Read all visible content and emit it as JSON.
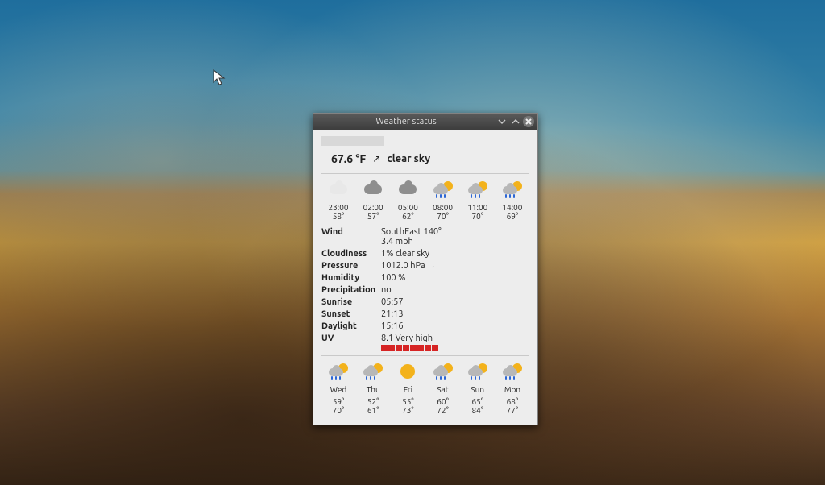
{
  "window": {
    "title": "Weather status"
  },
  "current": {
    "temp": "67.6 °F",
    "trend_arrow": "↗",
    "desc": "clear sky"
  },
  "hourly": [
    {
      "icon": "cloud-white",
      "time": "23:00",
      "temp": "58°"
    },
    {
      "icon": "cloud-dark",
      "time": "02:00",
      "temp": "57°"
    },
    {
      "icon": "cloud-dark",
      "time": "05:00",
      "temp": "62°"
    },
    {
      "icon": "rain-sun",
      "time": "08:00",
      "temp": "70°"
    },
    {
      "icon": "rain-sun",
      "time": "11:00",
      "temp": "70°"
    },
    {
      "icon": "rain-sun",
      "time": "14:00",
      "temp": "69°"
    }
  ],
  "details": {
    "wind_label": "Wind",
    "wind_value": "SouthEast 140°\n3.4 mph",
    "cloudiness_label": "Cloudiness",
    "cloudiness_value": "1% clear sky",
    "pressure_label": "Pressure",
    "pressure_value": "1012.0 hPa →",
    "humidity_label": "Humidity",
    "humidity_value": "100 %",
    "precip_label": "Precipitation",
    "precip_value": "no",
    "sunrise_label": "Sunrise",
    "sunrise_value": "05:57",
    "sunset_label": "Sunset",
    "sunset_value": "21:13",
    "daylight_label": "Daylight",
    "daylight_value": "15:16",
    "uv_label": "UV",
    "uv_value": "8.1 Very high",
    "uv_blocks": 8
  },
  "daily": [
    {
      "icon": "rain-sun",
      "day": "Wed",
      "lo": "59°",
      "hi": "70°"
    },
    {
      "icon": "rain-sun",
      "day": "Thu",
      "lo": "52°",
      "hi": "61°"
    },
    {
      "icon": "sun",
      "day": "Fri",
      "lo": "55°",
      "hi": "73°"
    },
    {
      "icon": "rain-sun",
      "day": "Sat",
      "lo": "60°",
      "hi": "72°"
    },
    {
      "icon": "rain-sun",
      "day": "Sun",
      "lo": "65°",
      "hi": "84°"
    },
    {
      "icon": "rain-sun",
      "day": "Mon",
      "lo": "68°",
      "hi": "77°"
    }
  ]
}
